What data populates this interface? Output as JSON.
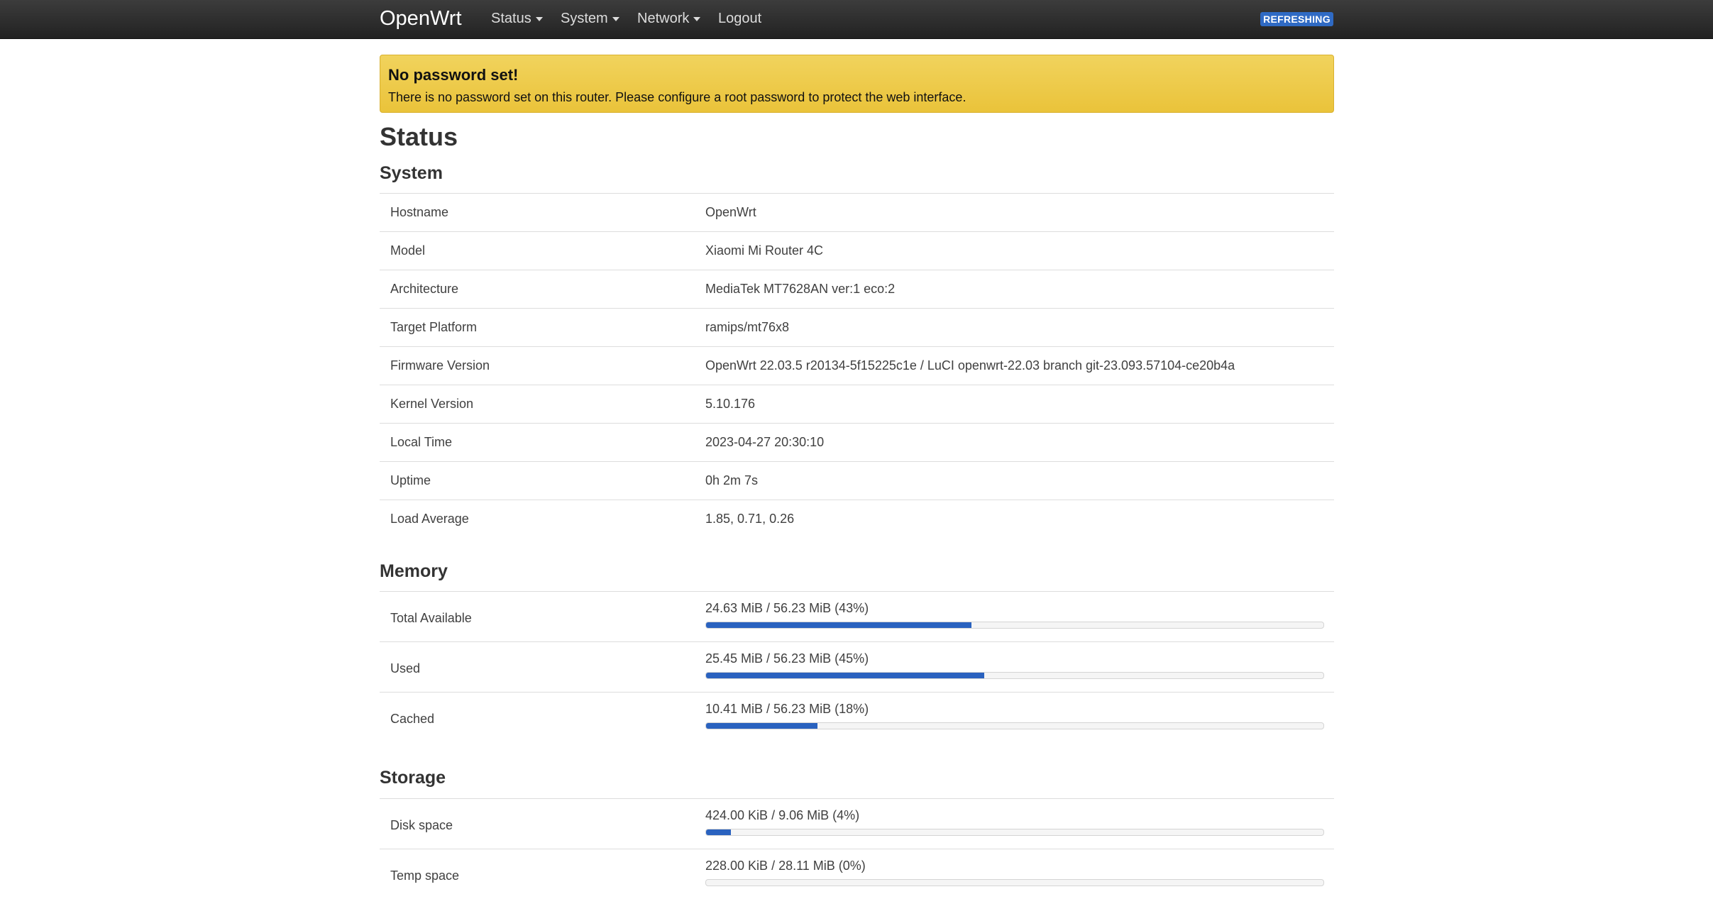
{
  "navbar": {
    "brand": "OpenWrt",
    "menu": [
      {
        "label": "Status",
        "dropdown": true
      },
      {
        "label": "System",
        "dropdown": true
      },
      {
        "label": "Network",
        "dropdown": true
      },
      {
        "label": "Logout",
        "dropdown": false
      }
    ],
    "badge": "REFRESHING"
  },
  "alert": {
    "title": "No password set!",
    "text": "There is no password set on this router. Please configure a root password to protect the web interface."
  },
  "page_title": "Status",
  "system": {
    "title": "System",
    "rows": [
      {
        "key": "Hostname",
        "value": "OpenWrt"
      },
      {
        "key": "Model",
        "value": "Xiaomi Mi Router 4C"
      },
      {
        "key": "Architecture",
        "value": "MediaTek MT7628AN ver:1 eco:2"
      },
      {
        "key": "Target Platform",
        "value": "ramips/mt76x8"
      },
      {
        "key": "Firmware Version",
        "value": "OpenWrt 22.03.5 r20134-5f15225c1e / LuCI openwrt-22.03 branch git-23.093.57104-ce20b4a"
      },
      {
        "key": "Kernel Version",
        "value": "5.10.176"
      },
      {
        "key": "Local Time",
        "value": "2023-04-27 20:30:10"
      },
      {
        "key": "Uptime",
        "value": "0h 2m 7s"
      },
      {
        "key": "Load Average",
        "value": "1.85, 0.71, 0.26"
      }
    ]
  },
  "memory": {
    "title": "Memory",
    "rows": [
      {
        "key": "Total Available",
        "value": "24.63 MiB / 56.23 MiB (43%)",
        "percent": 43
      },
      {
        "key": "Used",
        "value": "25.45 MiB / 56.23 MiB (45%)",
        "percent": 45
      },
      {
        "key": "Cached",
        "value": "10.41 MiB / 56.23 MiB (18%)",
        "percent": 18
      }
    ]
  },
  "storage": {
    "title": "Storage",
    "rows": [
      {
        "key": "Disk space",
        "value": "424.00 KiB / 9.06 MiB (4%)",
        "percent": 4
      },
      {
        "key": "Temp space",
        "value": "228.00 KiB / 28.11 MiB (0%)",
        "percent": 0
      }
    ]
  },
  "colors": {
    "navbar": "#2b2b2b",
    "alert": "#eec843",
    "progress_fill": "#2a62bf",
    "badge": "#2f6ac4"
  }
}
